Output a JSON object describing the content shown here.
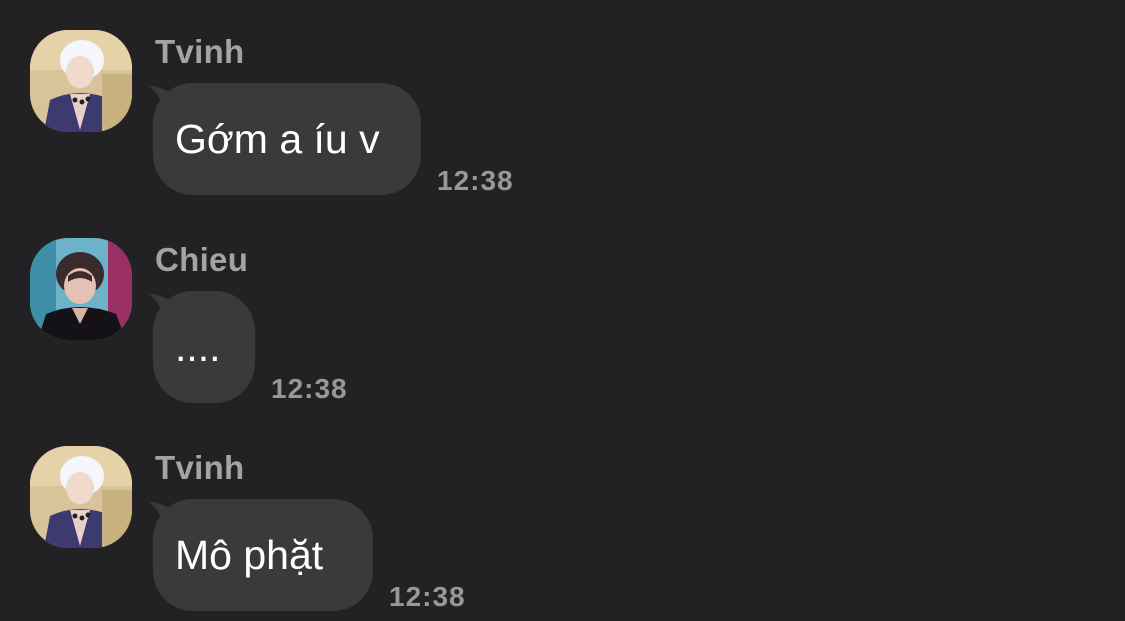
{
  "messages": [
    {
      "sender": "Tvinh",
      "text": "Gớm a íu v",
      "time": "12:38",
      "avatar": "tvinh-avatar"
    },
    {
      "sender": "Chieu",
      "text": "....",
      "time": "12:38",
      "avatar": "chieu-avatar"
    },
    {
      "sender": "Tvinh",
      "text": "Mô phặt",
      "time": "12:38",
      "avatar": "tvinh-avatar"
    }
  ],
  "colors": {
    "background": "#222224",
    "bubble": "#3a3a3c",
    "sender_name": "#a3a3a6",
    "timestamp": "#98989b",
    "message_text": "#ffffff"
  }
}
